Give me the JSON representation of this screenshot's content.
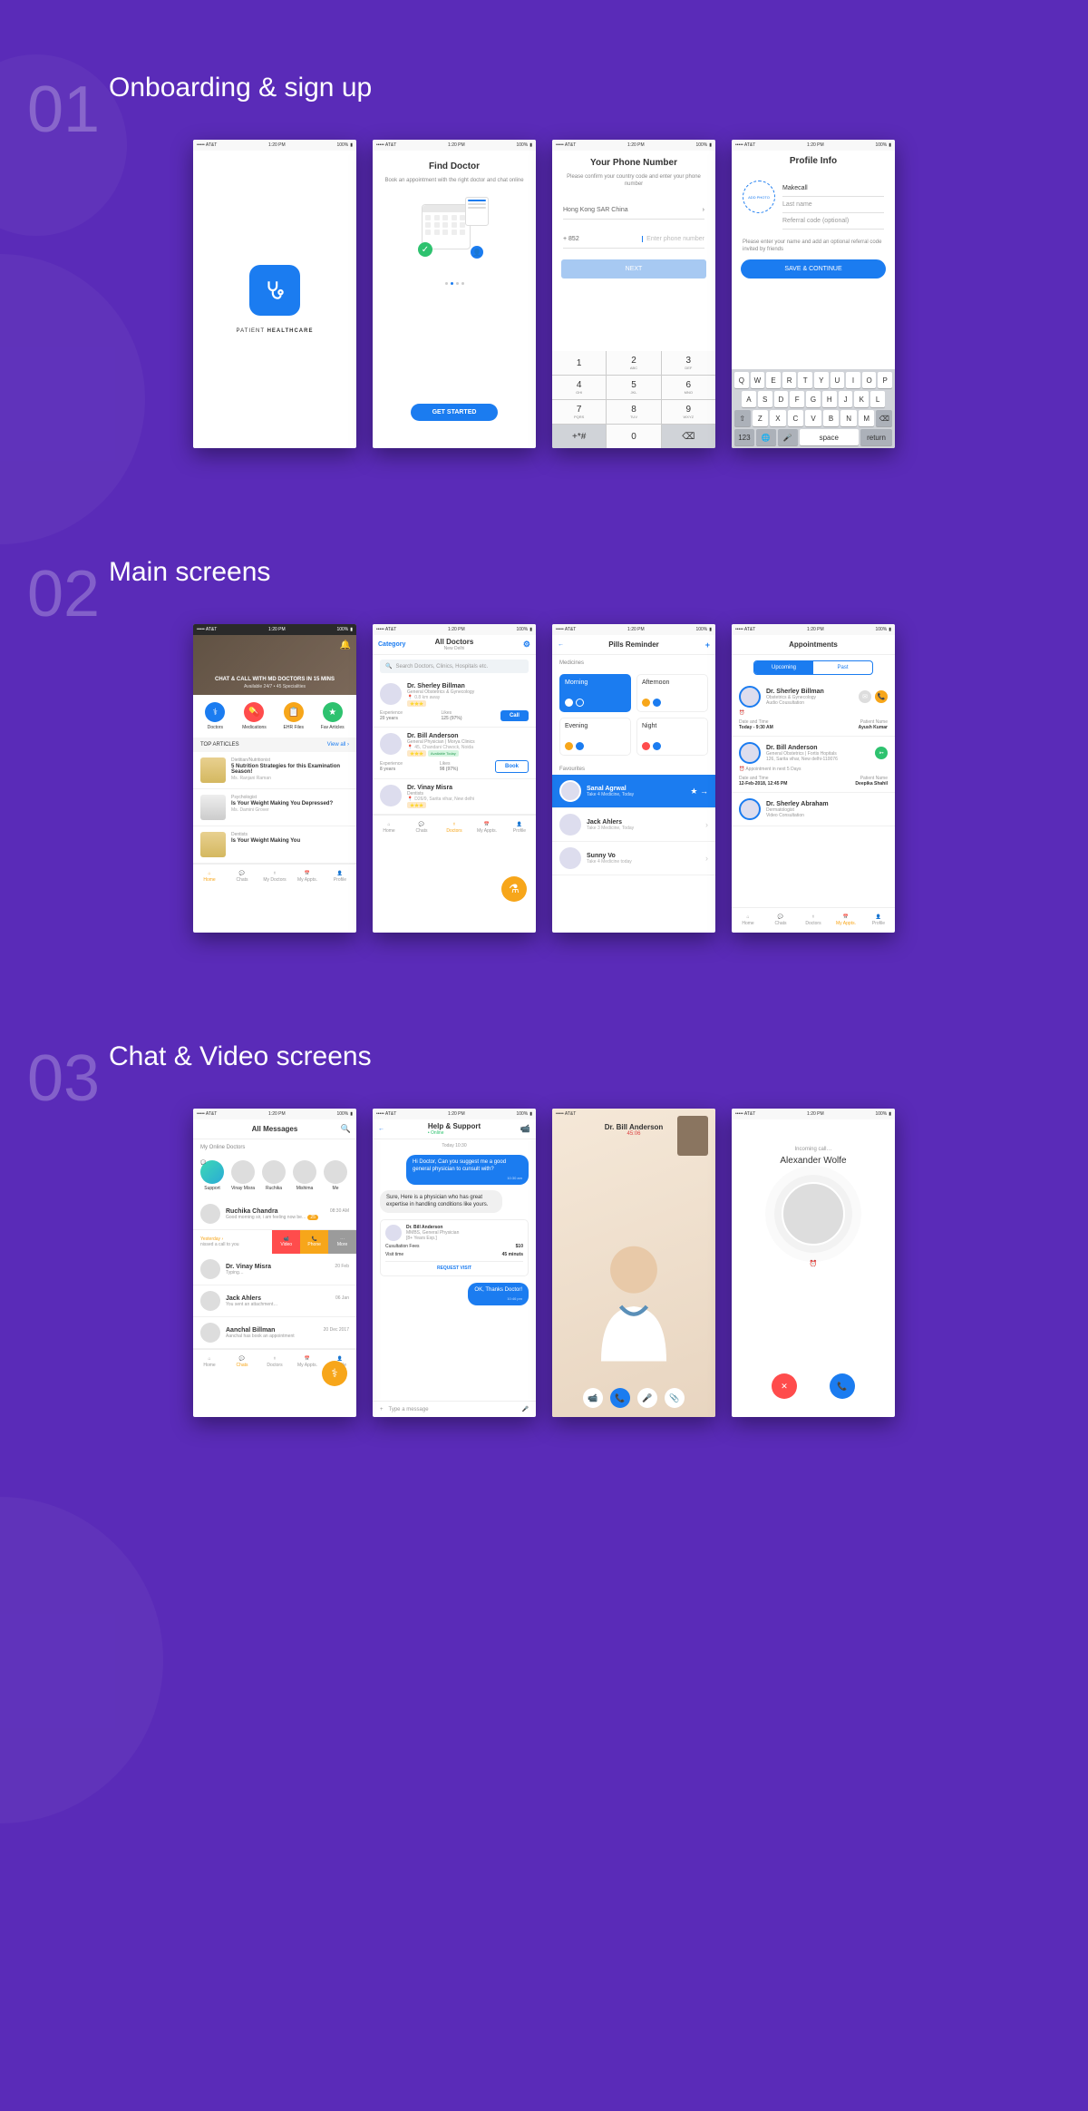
{
  "sections": [
    {
      "num": "01",
      "title": "Onboarding & sign up"
    },
    {
      "num": "02",
      "title": "Main screens"
    },
    {
      "num": "03",
      "title": "Chat & Video screens"
    }
  ],
  "status": {
    "carrier": "••••• AT&T",
    "wifi": "⌄",
    "time": "1:20 PM",
    "bt": "",
    "battery": "100%"
  },
  "s1": {
    "splash": {
      "brand_a": "PATIENT",
      "brand_b": "HEALTHCARE"
    },
    "find": {
      "title": "Find Doctor",
      "sub": "Book an appointment with the right doctor and chat online",
      "cta": "GET STARTED"
    },
    "phone": {
      "title": "Your Phone Number",
      "sub": "Please confirm your country code and enter your phone number",
      "country": "Hong Kong SAR China",
      "code": "+ 852",
      "placeholder": "Enter phone number",
      "next": "NEXT",
      "keys": [
        [
          "1",
          ""
        ],
        [
          "2",
          "ABC"
        ],
        [
          "3",
          "DEF"
        ],
        [
          "4",
          "GHI"
        ],
        [
          "5",
          "JKL"
        ],
        [
          "6",
          "MNO"
        ],
        [
          "7",
          "PQRS"
        ],
        [
          "8",
          "TUV"
        ],
        [
          "9",
          "WXYZ"
        ],
        [
          "+*#",
          ""
        ],
        [
          "0",
          ""
        ],
        [
          "⌫",
          ""
        ]
      ]
    },
    "profile": {
      "title": "Profile Info",
      "photo": "ADD PHOTO",
      "first": "Makecall",
      "last": "Last name",
      "referral": "Referral code (optional)",
      "hint": "Please enter your name and add an optional referral code invited by friends",
      "save": "SAVE & CONTINUE",
      "row1": [
        "Q",
        "W",
        "E",
        "R",
        "T",
        "Y",
        "U",
        "I",
        "O",
        "P"
      ],
      "row2": [
        "A",
        "S",
        "D",
        "F",
        "G",
        "H",
        "J",
        "K",
        "L"
      ],
      "row3": [
        "⇧",
        "Z",
        "X",
        "C",
        "V",
        "B",
        "N",
        "M",
        "⌫"
      ],
      "row4": [
        "123",
        "🌐",
        "🎤",
        "space",
        "return"
      ]
    }
  },
  "s2": {
    "home": {
      "hero_title": "CHAT & CALL WITH MD DOCTORS IN 15 MINS",
      "hero_sub": "Available 24/7 • 45 Specialities",
      "icons": [
        {
          "label": "Doctors",
          "color": "#1b7cf0"
        },
        {
          "label": "Medications",
          "color": "#ff4c4c"
        },
        {
          "label": "EHR Files",
          "color": "#f7a61a"
        },
        {
          "label": "Fav Articles",
          "color": "#2ec26f"
        }
      ],
      "top_label": "TOP ARTICLES",
      "view_all": "View all ›",
      "articles": [
        {
          "cat": "Dietitian/Nutritionist",
          "title": "5 Nutrition Strategies for this Examination Season!",
          "auth": "Ms. Ranjani Raman"
        },
        {
          "cat": "Psychologist",
          "title": "Is Your Weight Making You Depressed?",
          "auth": "Ms. Damini Grover"
        },
        {
          "cat": "Dentists",
          "title": "Is Your Weight Making You",
          "auth": ""
        }
      ],
      "tabs": [
        "Home",
        "Chats",
        "My Doctors",
        "My Appts.",
        "Profile"
      ]
    },
    "doctors": {
      "cat": "Category",
      "title": "All Doctors",
      "loc": "New Delhi",
      "search": "Search Doctors, Clinics, Hospitals etc.",
      "list": [
        {
          "name": "Dr. Sherley Billman",
          "spec": "General Obstetrics & Gynecology",
          "meta": "0.8 km away",
          "badge": "",
          "exp": "20 years",
          "likes": "125 (97%)",
          "btn": "Call"
        },
        {
          "name": "Dr. Bill Anderson",
          "spec": "General Physician | Morya Clinics",
          "meta": "45, Chandani Chwock, Noida",
          "badge": "Available Today",
          "exp": "8 years",
          "likes": "98 (97%)",
          "btn": "Book"
        },
        {
          "name": "Dr. Vinay Misra",
          "spec": "Dentists",
          "meta": "D26/9, Sarita vihar, New delhi",
          "badge": "",
          "exp": "",
          "likes": "",
          "btn": ""
        }
      ],
      "exp_label": "Experience",
      "likes_label": "Likes",
      "tabs": [
        "Home",
        "Chats",
        "Doctors",
        "My Appts.",
        "Profile"
      ]
    },
    "pills": {
      "title": "Pills Reminder",
      "sec_med": "Medicines",
      "times": [
        "Morning",
        "Afternoon",
        "Evening",
        "Night"
      ],
      "fav_label": "Favourites",
      "favs": [
        {
          "name": "Sanal Agrwal",
          "sub": "Take 4 Medicine, Today",
          "hl": true
        },
        {
          "name": "Jack Ahlers",
          "sub": "Take 3 Medicine, Today"
        },
        {
          "name": "Sunny Vo",
          "sub": "Take 4 Medicine today"
        }
      ]
    },
    "appts": {
      "title": "Appointments",
      "seg": [
        "Upcoming",
        "Past"
      ],
      "list": [
        {
          "name": "Dr. Sherley Billman",
          "spec": "Obstetrics & Gynecology",
          "type": "Audio Cousultation",
          "dt_label": "Date and Time",
          "dt": "Today - 9:30 AM",
          "pn_label": "Patient Name",
          "pn": "Ayush Kumar",
          "icons": [
            "gray",
            "orange"
          ]
        },
        {
          "name": "Dr. Bill Anderson",
          "spec": "General Obstetrics | Fortis Hopitals",
          "type": "126, Sarita vihar, New delhi-110076",
          "note": "Appointment in next 5 Days",
          "dt_label": "Date and Time",
          "dt": "12-Feb-2018, 12:45 PM",
          "pn_label": "Patient Name",
          "pn": "Deepika Shahil",
          "icons": [
            "green"
          ]
        },
        {
          "name": "Dr. Sherley Abraham",
          "spec": "Dermatologist",
          "type": "Video Consultation"
        }
      ],
      "tabs": [
        "Home",
        "Chats",
        "Doctors",
        "My Appts.",
        "Profile"
      ]
    }
  },
  "s3": {
    "messages": {
      "title": "All Messages",
      "label": "My Online Doctors",
      "online": [
        "Support",
        "Vinay Misra",
        "Ruchika",
        "Mishima",
        "Me"
      ],
      "chats": [
        {
          "name": "Ruchika Chandra",
          "msg": "Good morning sir, i am feeling now be…",
          "time": "08:30 AM",
          "badge": "25"
        },
        {
          "yesterday": "Yesterday ›",
          "missed": "nissed a call to you"
        },
        {
          "name": "Dr. Vinay Misra",
          "msg": "Typing…",
          "time": "20 Feb"
        },
        {
          "name": "Jack Ahlers",
          "msg": "You sent an attachment…",
          "time": "06 Jan"
        },
        {
          "name": "Aanchal Billman",
          "msg": "Aanchal has book an appointment",
          "time": "20 Dec 2017"
        }
      ],
      "actions": [
        {
          "label": "Video",
          "color": "#ff4c4c"
        },
        {
          "label": "Phone",
          "color": "#f7a61a"
        },
        {
          "label": "More",
          "color": "#9b9b9b"
        }
      ],
      "tabs": [
        "Home",
        "Chats",
        "Doctors",
        "My Appts.",
        "Profile"
      ]
    },
    "chat": {
      "title": "Help & Support",
      "status": "Online",
      "today": "Today 10:30",
      "m1": "Hi Doctor, Can you suggest me a good general physician to cunsult with?",
      "t1": "10:30 am",
      "m2": "Sure, Here is a physician who has great expertise in handling conditions like yours.",
      "doc": {
        "name": "Dr. Bill Anderson",
        "spec": "MMBS, General Physician",
        "exp": "[8+ Years Exp.]",
        "fee_l": "Cusultation Fees",
        "fee": "$10",
        "visit_l": "Visit time",
        "visit": "45 minuts",
        "btn": "REQUEST VISIT"
      },
      "m3": "OK, Thanks Doctor!",
      "t3": "10:46 pm",
      "input": "Type a message"
    },
    "video": {
      "name": "Dr. Bill Anderson",
      "time": "45:06"
    },
    "call": {
      "label": "Incoming call…",
      "name": "Alexander Wolfe"
    }
  }
}
